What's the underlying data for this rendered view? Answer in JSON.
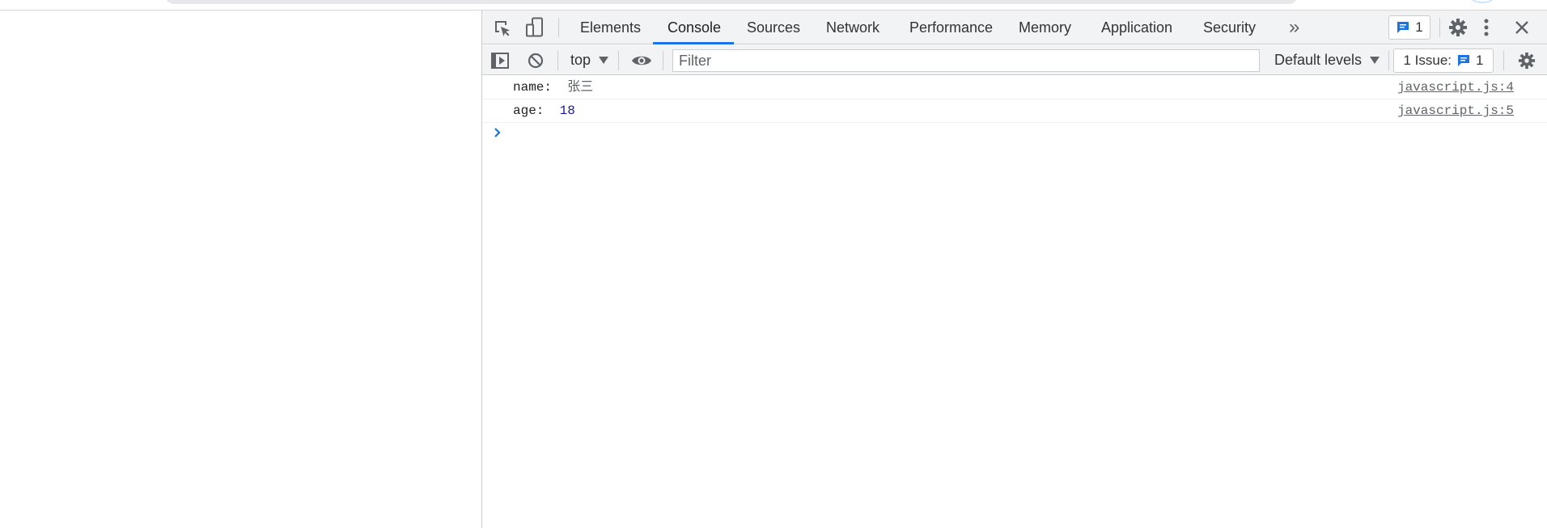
{
  "devtools": {
    "tabs": [
      {
        "label": "Elements",
        "active": false
      },
      {
        "label": "Console",
        "active": true
      },
      {
        "label": "Sources",
        "active": false
      },
      {
        "label": "Network",
        "active": false
      },
      {
        "label": "Performance",
        "active": false
      },
      {
        "label": "Memory",
        "active": false
      },
      {
        "label": "Application",
        "active": false
      },
      {
        "label": "Security",
        "active": false
      }
    ],
    "more_tabs_glyph": "»",
    "messages_badge_count": "1",
    "icons": [
      "inspect-element-icon",
      "device-toolbar-icon",
      "more-tabs-icon",
      "message-icon",
      "settings-gear-icon",
      "kebab-menu-icon",
      "close-icon",
      "sidebar-toggle-icon",
      "clear-console-icon",
      "eye-icon"
    ]
  },
  "console_toolbar": {
    "context": "top",
    "filter_placeholder": "Filter",
    "filter_value": "",
    "levels_label": "Default levels",
    "issues_label": "1 Issue:",
    "issues_count": "1"
  },
  "console": {
    "messages": [
      {
        "key": "name:",
        "value": "张三",
        "value_type": "string",
        "source": "javascript.js:4"
      },
      {
        "key": "age:",
        "value": "18",
        "value_type": "number",
        "source": "javascript.js:5"
      }
    ],
    "prompt_glyph": "›"
  },
  "colors": {
    "accent": "#1a73e8",
    "toolbar_bg": "#f1f3f4",
    "border": "#cbcdd1",
    "number_value": "#1a1aa6",
    "string_value": "#5f6368"
  }
}
